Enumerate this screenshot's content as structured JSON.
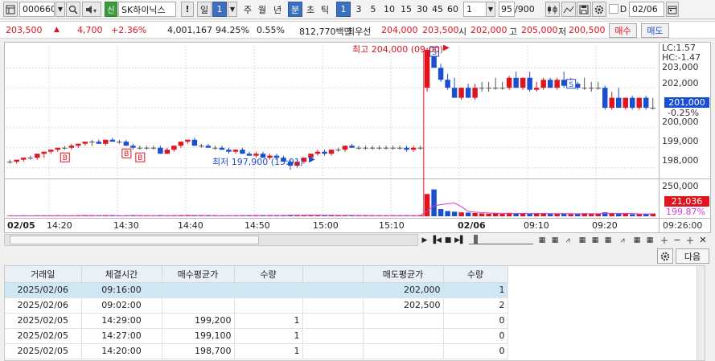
{
  "toolbar": {
    "stock_code": "000660",
    "search_icon": "magnifier-icon",
    "sound_icon": "speaker-icon",
    "badge": "신",
    "stock_name": "SK하이닉스",
    "alert": "!",
    "period_daily": "일",
    "period_daily_value": "1",
    "weekly": "주",
    "monthly": "월",
    "yearly": "년",
    "minute": "분",
    "second": "초",
    "tick": "틱",
    "intervals": [
      "1",
      "3",
      "5",
      "10",
      "15",
      "30",
      "45",
      "60"
    ],
    "interval_value": "1",
    "count": "95",
    "count_total": "/900",
    "date_check": "D",
    "date": "02/06"
  },
  "quote": {
    "price": "203,500",
    "change": "4,700",
    "change_pct": "+2.36%",
    "volume": "4,001,167",
    "volume_ratio": "94.25%",
    "turnover": "0.55%",
    "amount": "812,770백만",
    "best_label": "최우선",
    "best_sell": "204,000",
    "best_buy": "203,500",
    "open_label": "시",
    "open": "202,000",
    "high_label": "고",
    "high": "205,000",
    "low_label": "저",
    "low": "200,500",
    "buy_button": "매수",
    "sell_button": "매도"
  },
  "chart": {
    "annotations": {
      "high": "최고 204,000 (09:00)",
      "low": "최저 197,900 (15:01)"
    },
    "lc_label": "LC:1.57",
    "hc_label": "HC:-1.47",
    "current_price": "201,000",
    "current_change": "-0.25%",
    "volume_current": "21,036",
    "volume_pct": "199.87%",
    "price_ticks": [
      "203,000",
      "202,000",
      "201,000",
      "200,000",
      "199,000",
      "198,000"
    ],
    "volume_tick": "250,000",
    "x_labels": [
      {
        "label": "02/05",
        "bold": true
      },
      {
        "label": "14:20",
        "bold": false
      },
      {
        "label": "14:30",
        "bold": false
      },
      {
        "label": "14:40",
        "bold": false
      },
      {
        "label": "14:50",
        "bold": false
      },
      {
        "label": "15:00",
        "bold": false
      },
      {
        "label": "15:10",
        "bold": false
      },
      {
        "label": "02/06",
        "bold": true
      },
      {
        "label": "09:10",
        "bold": false
      },
      {
        "label": "09:20",
        "bold": false
      }
    ],
    "time_label": "09:26:00",
    "colors": {
      "up": "#e0141e",
      "down": "#1b4fd1",
      "flat": "#555555",
      "ma": "#d63ad6"
    }
  },
  "chart_data": {
    "type": "candlestick",
    "ylim": [
      197500,
      204100
    ],
    "volume_ylim": [
      0,
      270000
    ],
    "candles": [
      {
        "o": 198300,
        "h": 198400,
        "l": 198200,
        "c": 198300
      },
      {
        "o": 198300,
        "h": 198400,
        "l": 198200,
        "c": 198400
      },
      {
        "o": 198400,
        "h": 198500,
        "l": 198300,
        "c": 198500
      },
      {
        "o": 198500,
        "h": 198600,
        "l": 198400,
        "c": 198500
      },
      {
        "o": 198500,
        "h": 198700,
        "l": 198400,
        "c": 198700
      },
      {
        "o": 198700,
        "h": 198800,
        "l": 198500,
        "c": 198800
      },
      {
        "o": 198800,
        "h": 198900,
        "l": 198700,
        "c": 198900
      },
      {
        "o": 198900,
        "h": 199000,
        "l": 198800,
        "c": 199000
      },
      {
        "o": 199000,
        "h": 199100,
        "l": 198900,
        "c": 199000
      },
      {
        "o": 199000,
        "h": 199200,
        "l": 198900,
        "c": 199100
      },
      {
        "o": 199100,
        "h": 199200,
        "l": 199000,
        "c": 199200
      },
      {
        "o": 199200,
        "h": 199300,
        "l": 199100,
        "c": 199300
      },
      {
        "o": 199300,
        "h": 199400,
        "l": 199100,
        "c": 199300
      },
      {
        "o": 199300,
        "h": 199400,
        "l": 199200,
        "c": 199200
      },
      {
        "o": 199200,
        "h": 199400,
        "l": 199100,
        "c": 199400
      },
      {
        "o": 199400,
        "h": 199500,
        "l": 199300,
        "c": 199300
      },
      {
        "o": 199300,
        "h": 199400,
        "l": 199200,
        "c": 199300
      },
      {
        "o": 199300,
        "h": 199400,
        "l": 199100,
        "c": 199100
      },
      {
        "o": 199100,
        "h": 199200,
        "l": 198900,
        "c": 199000
      },
      {
        "o": 199000,
        "h": 199100,
        "l": 198900,
        "c": 199000
      },
      {
        "o": 199000,
        "h": 199100,
        "l": 198900,
        "c": 199000
      },
      {
        "o": 199000,
        "h": 199100,
        "l": 198900,
        "c": 199000
      },
      {
        "o": 199000,
        "h": 199100,
        "l": 198700,
        "c": 198700
      },
      {
        "o": 198700,
        "h": 199000,
        "l": 198700,
        "c": 198900
      },
      {
        "o": 198900,
        "h": 199100,
        "l": 198800,
        "c": 199100
      },
      {
        "o": 199100,
        "h": 199300,
        "l": 199000,
        "c": 199300
      },
      {
        "o": 199300,
        "h": 199400,
        "l": 199200,
        "c": 199400
      },
      {
        "o": 199400,
        "h": 199500,
        "l": 199100,
        "c": 199100
      },
      {
        "o": 199100,
        "h": 199200,
        "l": 199000,
        "c": 199100
      },
      {
        "o": 199100,
        "h": 199200,
        "l": 199000,
        "c": 199000
      },
      {
        "o": 199000,
        "h": 199100,
        "l": 198900,
        "c": 199000
      },
      {
        "o": 199000,
        "h": 199100,
        "l": 198900,
        "c": 198900
      },
      {
        "o": 198900,
        "h": 199000,
        "l": 198700,
        "c": 198800
      },
      {
        "o": 198800,
        "h": 198900,
        "l": 198700,
        "c": 198900
      },
      {
        "o": 198900,
        "h": 199000,
        "l": 198700,
        "c": 198700
      },
      {
        "o": 198700,
        "h": 198800,
        "l": 198600,
        "c": 198600
      },
      {
        "o": 198600,
        "h": 198800,
        "l": 198500,
        "c": 198700
      },
      {
        "o": 198700,
        "h": 198800,
        "l": 198500,
        "c": 198500
      },
      {
        "o": 198500,
        "h": 198700,
        "l": 198400,
        "c": 198600
      },
      {
        "o": 198600,
        "h": 198700,
        "l": 198400,
        "c": 198500
      },
      {
        "o": 198500,
        "h": 198600,
        "l": 198300,
        "c": 198300
      },
      {
        "o": 198300,
        "h": 198400,
        "l": 197900,
        "c": 198100
      },
      {
        "o": 198100,
        "h": 198400,
        "l": 198000,
        "c": 198300
      },
      {
        "o": 198300,
        "h": 198500,
        "l": 198200,
        "c": 198500
      },
      {
        "o": 198500,
        "h": 198700,
        "l": 198400,
        "c": 198700
      },
      {
        "o": 198700,
        "h": 198900,
        "l": 198600,
        "c": 198800
      },
      {
        "o": 198800,
        "h": 198900,
        "l": 198600,
        "c": 198700
      },
      {
        "o": 198700,
        "h": 198900,
        "l": 198600,
        "c": 198900
      },
      {
        "o": 198900,
        "h": 199000,
        "l": 198800,
        "c": 198900
      },
      {
        "o": 198900,
        "h": 199100,
        "l": 198800,
        "c": 199100
      },
      {
        "o": 199100,
        "h": 199200,
        "l": 199000,
        "c": 199000
      },
      {
        "o": 199000,
        "h": 199100,
        "l": 198900,
        "c": 199000
      },
      {
        "o": 199000,
        "h": 199100,
        "l": 198900,
        "c": 199000
      },
      {
        "o": 199000,
        "h": 199100,
        "l": 198900,
        "c": 199000
      },
      {
        "o": 199000,
        "h": 199100,
        "l": 198900,
        "c": 199000
      },
      {
        "o": 199000,
        "h": 199100,
        "l": 198900,
        "c": 199000
      },
      {
        "o": 199000,
        "h": 199100,
        "l": 198900,
        "c": 199000
      },
      {
        "o": 199000,
        "h": 199100,
        "l": 198900,
        "c": 199000
      },
      {
        "o": 199000,
        "h": 199100,
        "l": 198800,
        "c": 198900
      },
      {
        "o": 198900,
        "h": 199100,
        "l": 198800,
        "c": 199000
      },
      {
        "o": 199000,
        "h": 199100,
        "l": 198900,
        "c": 199000
      },
      {
        "o": 202000,
        "h": 204000,
        "l": 201800,
        "c": 203900
      },
      {
        "o": 204000,
        "h": 204100,
        "l": 203000,
        "c": 203000
      },
      {
        "o": 203000,
        "h": 203200,
        "l": 202300,
        "c": 202400
      },
      {
        "o": 202400,
        "h": 202700,
        "l": 201900,
        "c": 202000
      },
      {
        "o": 202000,
        "h": 202500,
        "l": 201500,
        "c": 201500
      },
      {
        "o": 201500,
        "h": 202000,
        "l": 201400,
        "c": 202000
      },
      {
        "o": 202000,
        "h": 202200,
        "l": 201500,
        "c": 201500
      },
      {
        "o": 201500,
        "h": 202200,
        "l": 201400,
        "c": 202000
      },
      {
        "o": 202000,
        "h": 202300,
        "l": 201800,
        "c": 202000
      },
      {
        "o": 202000,
        "h": 202300,
        "l": 201800,
        "c": 202000
      },
      {
        "o": 202000,
        "h": 202500,
        "l": 201900,
        "c": 202000
      },
      {
        "o": 202000,
        "h": 202300,
        "l": 201900,
        "c": 202000
      },
      {
        "o": 202000,
        "h": 202600,
        "l": 201900,
        "c": 202500
      },
      {
        "o": 202500,
        "h": 202800,
        "l": 202000,
        "c": 202000
      },
      {
        "o": 202000,
        "h": 202500,
        "l": 201900,
        "c": 202500
      },
      {
        "o": 202500,
        "h": 202800,
        "l": 201800,
        "c": 201900
      },
      {
        "o": 201900,
        "h": 202300,
        "l": 201800,
        "c": 202000
      },
      {
        "o": 202000,
        "h": 202500,
        "l": 201900,
        "c": 202400
      },
      {
        "o": 202400,
        "h": 202500,
        "l": 202000,
        "c": 202000
      },
      {
        "o": 202000,
        "h": 202500,
        "l": 201900,
        "c": 202400
      },
      {
        "o": 202400,
        "h": 202800,
        "l": 202000,
        "c": 202100
      },
      {
        "o": 202100,
        "h": 202500,
        "l": 202000,
        "c": 202200
      },
      {
        "o": 202200,
        "h": 202300,
        "l": 201900,
        "c": 202000
      },
      {
        "o": 202000,
        "h": 202500,
        "l": 201900,
        "c": 202000
      },
      {
        "o": 202000,
        "h": 202300,
        "l": 201800,
        "c": 202000
      },
      {
        "o": 202000,
        "h": 202300,
        "l": 201900,
        "c": 202000
      },
      {
        "o": 202000,
        "h": 202100,
        "l": 200900,
        "c": 201000
      },
      {
        "o": 201000,
        "h": 201800,
        "l": 200900,
        "c": 201500
      },
      {
        "o": 201500,
        "h": 202000,
        "l": 201000,
        "c": 201000
      },
      {
        "o": 201000,
        "h": 201500,
        "l": 200900,
        "c": 201500
      },
      {
        "o": 201500,
        "h": 201600,
        "l": 200900,
        "c": 201000
      },
      {
        "o": 201000,
        "h": 201500,
        "l": 200900,
        "c": 201500
      },
      {
        "o": 201500,
        "h": 201600,
        "l": 200900,
        "c": 201000
      },
      {
        "o": 201000,
        "h": 201500,
        "l": 200900,
        "c": 201000
      }
    ],
    "volumes": [
      4000,
      3000,
      5000,
      3000,
      6000,
      4000,
      5000,
      7000,
      4000,
      6000,
      5000,
      8000,
      6000,
      4000,
      7000,
      5000,
      4000,
      6000,
      8000,
      5000,
      4000,
      3000,
      9000,
      5000,
      6000,
      7000,
      8000,
      6000,
      4000,
      5000,
      4000,
      6000,
      7000,
      5000,
      6000,
      8000,
      5000,
      7000,
      6000,
      5000,
      9000,
      10000,
      8000,
      9000,
      8000,
      7000,
      6000,
      8000,
      6000,
      7000,
      6000,
      5000,
      6000,
      5000,
      6000,
      5000,
      6000,
      5000,
      7000,
      6000,
      8000,
      170000,
      205000,
      55000,
      40000,
      35000,
      30000,
      28000,
      25000,
      22000,
      20000,
      24000,
      18000,
      26000,
      20000,
      22000,
      19000,
      21000,
      24000,
      18000,
      20000,
      22000,
      17000,
      19000,
      23000,
      18000,
      20000,
      30000,
      22000,
      18000,
      19000,
      16000,
      18000,
      17000,
      21036
    ],
    "signals": [
      {
        "index": 8,
        "label": "B",
        "type": "buy"
      },
      {
        "index": 17,
        "label": "B",
        "type": "buy"
      },
      {
        "index": 19,
        "label": "B",
        "type": "buy"
      },
      {
        "index": 62,
        "label": "S",
        "type": "sell"
      },
      {
        "index": 82,
        "label": "S",
        "type": "sell"
      }
    ]
  },
  "lower": {
    "settings_icon": "gear-icon",
    "next_button": "다음",
    "columns": [
      "거래일",
      "체결시간",
      "매수평균가",
      "수량",
      "",
      "매도평균가",
      "수량"
    ],
    "rows": [
      [
        "2025/02/06",
        "09:16:00",
        "",
        "",
        "",
        "202,000",
        "1"
      ],
      [
        "2025/02/06",
        "09:02:00",
        "",
        "",
        "",
        "202,500",
        "2"
      ],
      [
        "2025/02/05",
        "14:29:00",
        "199,200",
        "1",
        "",
        "",
        "0"
      ],
      [
        "2025/02/05",
        "14:27:00",
        "199,100",
        "1",
        "",
        "",
        "0"
      ],
      [
        "2025/02/05",
        "14:20:00",
        "198,700",
        "1",
        "",
        "",
        "0"
      ]
    ]
  }
}
